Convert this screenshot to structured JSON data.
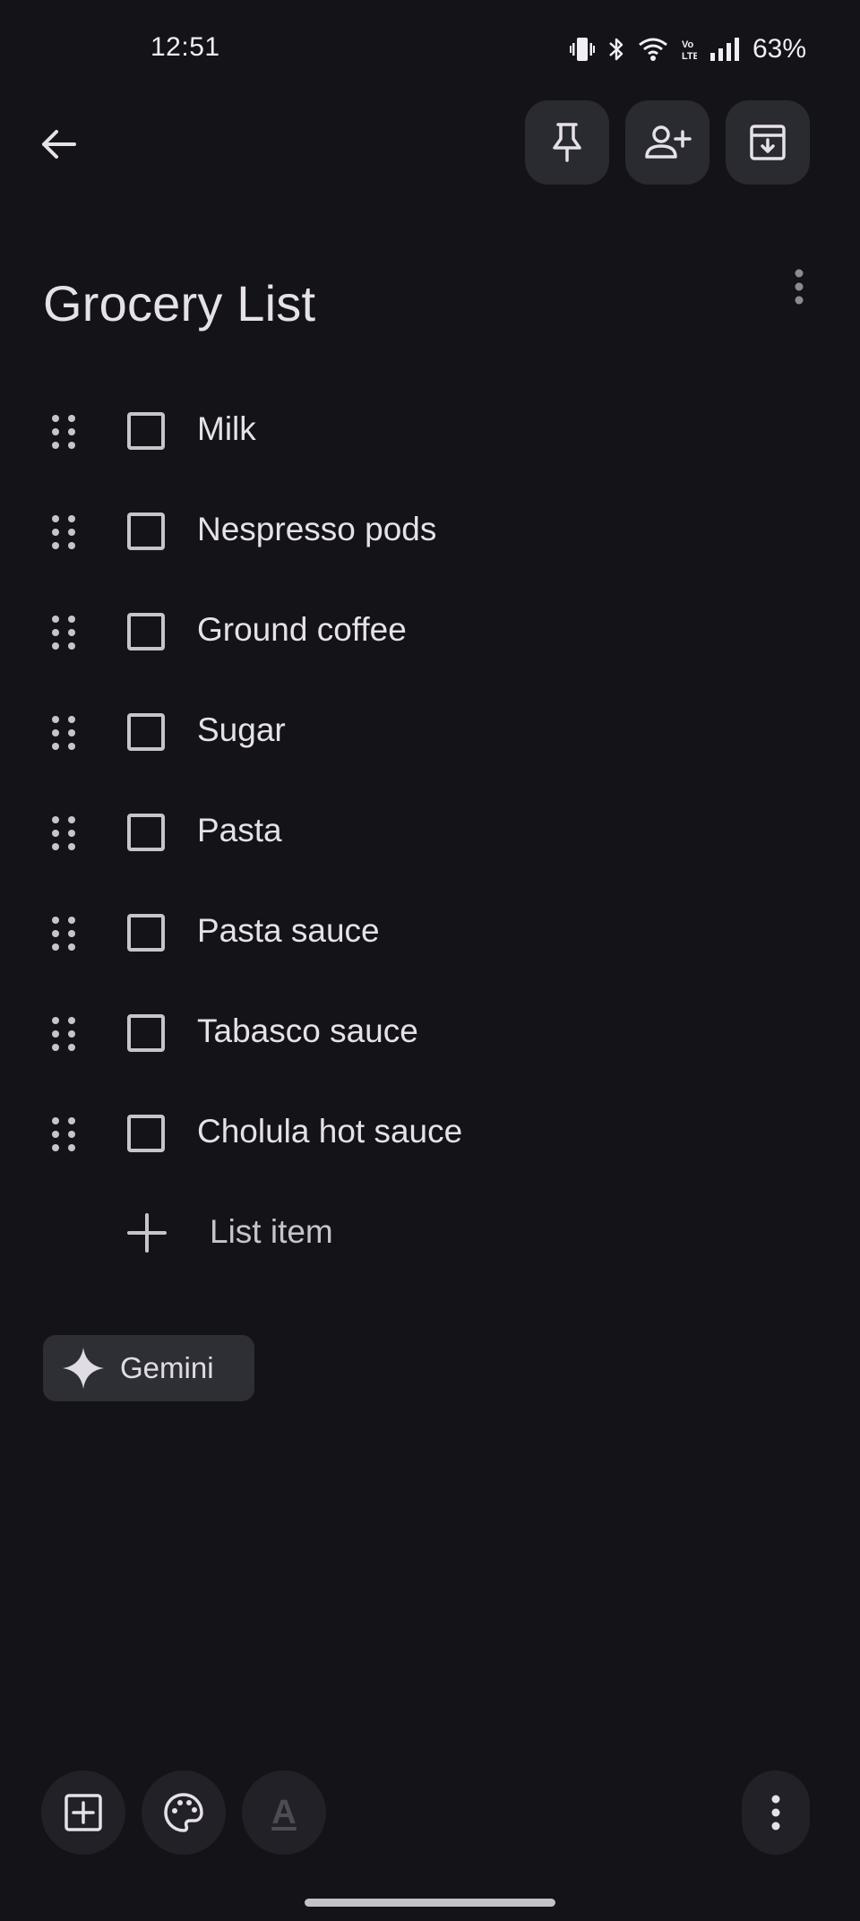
{
  "status_bar": {
    "time": "12:51",
    "battery": "63%",
    "icons": [
      "vibrate-icon",
      "bluetooth-icon",
      "wifi-icon",
      "volte-icon",
      "signal-icon"
    ]
  },
  "toolbar": {
    "back_icon": "arrow-back-icon",
    "actions": [
      "pin-icon",
      "add-collaborator-icon",
      "archive-icon"
    ]
  },
  "note": {
    "title": "Grocery List",
    "items": [
      {
        "text": "Milk",
        "checked": false
      },
      {
        "text": "Nespresso pods",
        "checked": false
      },
      {
        "text": "Ground coffee",
        "checked": false
      },
      {
        "text": "Sugar",
        "checked": false
      },
      {
        "text": "Pasta",
        "checked": false
      },
      {
        "text": "Pasta sauce",
        "checked": false
      },
      {
        "text": "Tabasco sauce",
        "checked": false
      },
      {
        "text": "Cholula hot sauce",
        "checked": false
      }
    ],
    "add_item_label": "List item"
  },
  "gemini": {
    "label": "Gemini"
  },
  "bottom_bar": {
    "format_glyph": "A",
    "icons": [
      "add-box-icon",
      "palette-icon",
      "text-format-icon",
      "more-vert-icon"
    ]
  },
  "colors": {
    "background": "#131318",
    "button_bg": "#2a2a31",
    "text": "#e6e1e8",
    "muted": "#c8c4cc"
  }
}
